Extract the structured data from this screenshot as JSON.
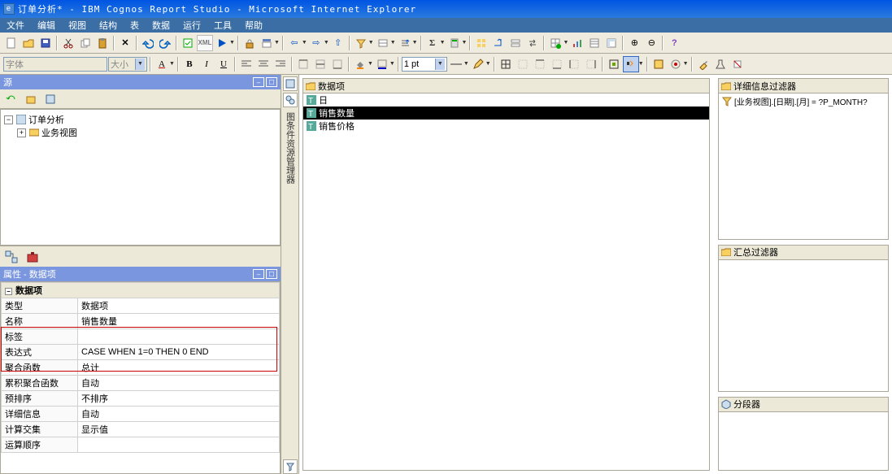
{
  "window": {
    "title": "订单分析* - IBM Cognos Report Studio - Microsoft Internet Explorer"
  },
  "menu": [
    "文件",
    "编辑",
    "视图",
    "结构",
    "表",
    "数据",
    "运行",
    "工具",
    "帮助"
  ],
  "combos": {
    "font_label": "字体",
    "size_label": "大小",
    "pt_label": "1 pt"
  },
  "source": {
    "header": "源",
    "tree_root": "订单分析",
    "tree_child": "业务视图"
  },
  "props": {
    "header": "属性 - 数据项",
    "group": "数据项",
    "rows": [
      {
        "k": "类型",
        "v": "数据项"
      },
      {
        "k": "名称",
        "v": "销售数量"
      },
      {
        "k": "标签",
        "v": ""
      },
      {
        "k": "表达式",
        "v": "CASE WHEN 1=0 THEN 0 END"
      },
      {
        "k": "聚合函数",
        "v": "总计"
      },
      {
        "k": "累积聚合函数",
        "v": "自动"
      },
      {
        "k": "预排序",
        "v": "不排序"
      },
      {
        "k": "详细信息",
        "v": "自动"
      },
      {
        "k": "计算交集",
        "v": "显示值"
      },
      {
        "k": "运算顺序",
        "v": ""
      }
    ]
  },
  "midstrip": {
    "label": "图条件资源管理器"
  },
  "data_items": {
    "header": "数据项",
    "items": [
      "日",
      "销售数量",
      "销售价格"
    ],
    "selected_index": 1
  },
  "detail_filter": {
    "header": "详细信息过滤器",
    "expr": "[业务视图].[日期].[月] = ?P_MONTH?"
  },
  "summary_filter": {
    "header": "汇总过滤器"
  },
  "slicer": {
    "header": "分段器"
  }
}
